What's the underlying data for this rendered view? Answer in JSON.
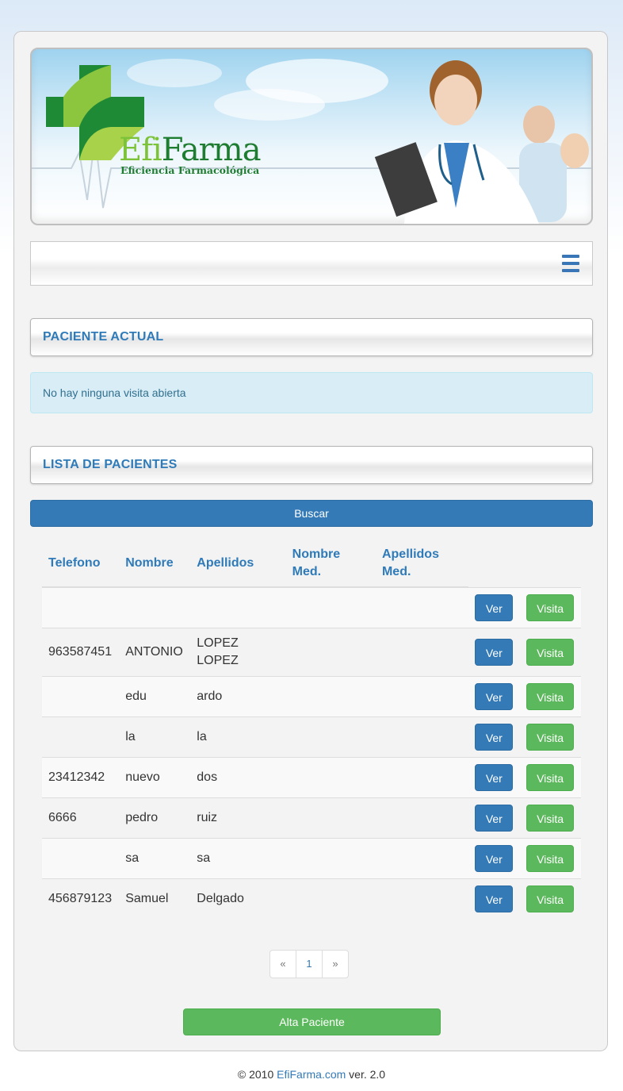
{
  "banner": {
    "logo_efi": "Efi",
    "logo_farma": "Farma",
    "logo_tagline": "Eficiencia Farmacológica"
  },
  "navbar": {
    "menu_icon": "hamburger-menu-icon"
  },
  "current_patient": {
    "heading": "PACIENTE ACTUAL",
    "alert": "No hay ninguna visita abierta"
  },
  "patient_list": {
    "heading": "LISTA DE PACIENTES",
    "search_label": "Buscar",
    "columns": [
      "Telefono",
      "Nombre",
      "Apellidos",
      "Nombre Med.",
      "Apellidos Med."
    ],
    "view_label": "Ver",
    "visit_label": "Visita",
    "rows": [
      {
        "telefono": "",
        "nombre": "",
        "apellidos": "",
        "nombre_med": "",
        "apellidos_med": ""
      },
      {
        "telefono": "963587451",
        "nombre": "ANTONIO",
        "apellidos": "LOPEZ LOPEZ",
        "nombre_med": "",
        "apellidos_med": ""
      },
      {
        "telefono": "",
        "nombre": "edu",
        "apellidos": "ardo",
        "nombre_med": "",
        "apellidos_med": ""
      },
      {
        "telefono": "",
        "nombre": "la",
        "apellidos": "la",
        "nombre_med": "",
        "apellidos_med": ""
      },
      {
        "telefono": "23412342",
        "nombre": "nuevo",
        "apellidos": "dos",
        "nombre_med": "",
        "apellidos_med": ""
      },
      {
        "telefono": "6666",
        "nombre": "pedro",
        "apellidos": "ruiz",
        "nombre_med": "",
        "apellidos_med": ""
      },
      {
        "telefono": "",
        "nombre": "sa",
        "apellidos": "sa",
        "nombre_med": "",
        "apellidos_med": ""
      },
      {
        "telefono": "456879123",
        "nombre": "Samuel",
        "apellidos": "Delgado",
        "nombre_med": "",
        "apellidos_med": ""
      }
    ]
  },
  "pagination": {
    "prev": "«",
    "page": "1",
    "next": "»"
  },
  "add_patient_label": "Alta Paciente",
  "footer": {
    "prefix": "© 2010 ",
    "link": "EfiFarma.com",
    "suffix": " ver. 2.0"
  },
  "colors": {
    "primary": "#337ab7",
    "success": "#5cb85c",
    "heading": "#2f7ab8",
    "alert_bg": "#d9edf7"
  }
}
